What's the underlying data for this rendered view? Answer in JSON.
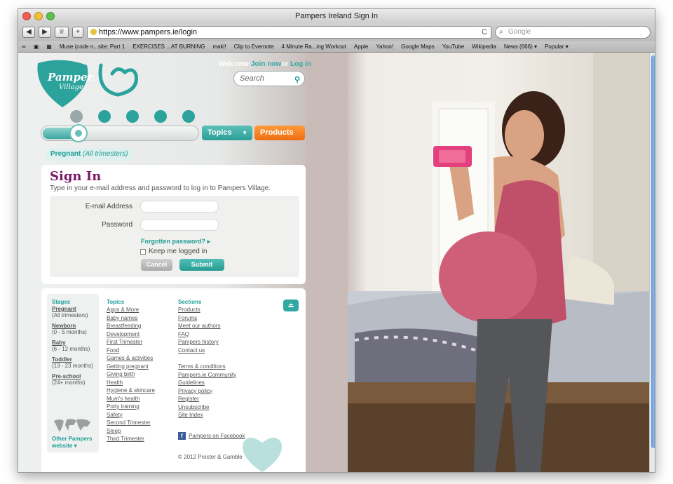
{
  "window": {
    "title": "Pampers Ireland Sign In"
  },
  "toolbar": {
    "back": "◀",
    "fwd": "▶",
    "url": "https://www.pampers.ie/login",
    "search_placeholder": "Google",
    "reload": "C"
  },
  "bookmarks": [
    "Muse (code n...site: Part 1",
    "EXERCISES ...AT BURNING",
    "maki!",
    "Clip to Evernote",
    "4 Minute Ra...ing Workout",
    "Apple",
    "Yahoo!",
    "Google Maps",
    "YouTube",
    "Wikipedia",
    "News (666) ▾",
    "Popular ▾"
  ],
  "header": {
    "welcome": "Welcome",
    "join": "Join now",
    "or": "or",
    "login": "Log in",
    "search_placeholder": "Search",
    "logo_text": "Pampers",
    "logo_sub": "Village"
  },
  "nav": {
    "topics": "Topics",
    "products": "Products",
    "stage": "Pregnant",
    "stage_sub": "(All trimesters)"
  },
  "signin": {
    "title": "Sign In",
    "subtitle": "Type in your e-mail address and password to log in to Pampers Village.",
    "email_label": "E-mail Address",
    "password_label": "Password",
    "forgot": "Forgotten password?",
    "keep": "Keep me logged in",
    "cancel": "Cancel",
    "submit": "Submit"
  },
  "footer": {
    "stages_title": "Stages",
    "stages": [
      {
        "name": "Pregnant",
        "sub": "(All trimesters)"
      },
      {
        "name": "Newborn",
        "sub": "(0 - 5 months)"
      },
      {
        "name": "Baby",
        "sub": "(6 - 12 months)"
      },
      {
        "name": "Toddler",
        "sub": "(13 - 23 months)"
      },
      {
        "name": "Pre-school",
        "sub": "(24+ months)"
      }
    ],
    "other_websites": "Other Pampers website ▾",
    "topics_title": "Topics",
    "topics": [
      "Apps & More",
      "Baby names",
      "Breastfeeding",
      "Development",
      "First Trimester",
      "Food",
      "Games & activities",
      "Getting pregnant",
      "Giving birth",
      "Health",
      "Hygiene & skincare",
      "Mum's health",
      "Potty training",
      "Safety",
      "Second Trimester",
      "Sleep",
      "Third Trimester"
    ],
    "sections_title": "Sections",
    "sections": [
      "Products",
      "Forums",
      "Meet our authors",
      "FAQ",
      "Pampers history",
      "Contact us"
    ],
    "legal": [
      "Terms & conditions",
      "Pampers.ie Community",
      "Guidelines",
      "Privacy policy",
      "Register",
      "Unsubscribe",
      "Site Index"
    ],
    "facebook": "Pampers on Facebook",
    "copyright": "© 2012 Procter & Gamble"
  }
}
